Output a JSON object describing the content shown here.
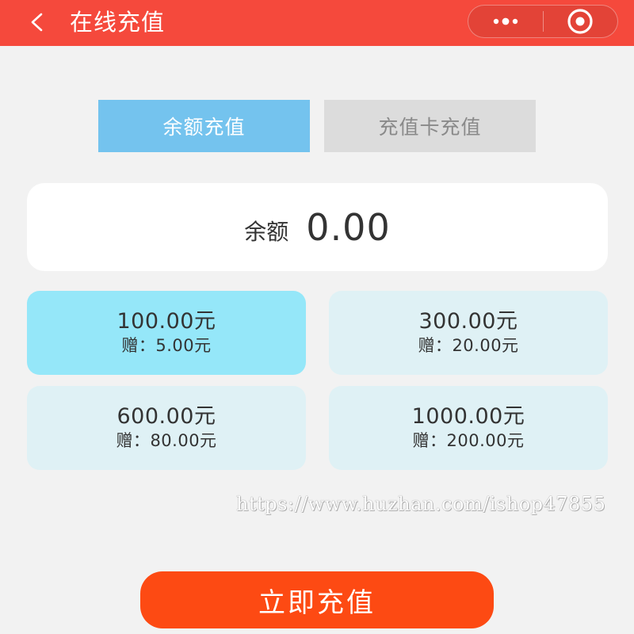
{
  "header": {
    "title": "在线充值",
    "back_icon": "chevron-left-icon",
    "more_icon": "more-dots-icon",
    "close_icon": "target-circle-icon",
    "bg_color": "#f5493c"
  },
  "tabs": [
    {
      "label": "余额充值",
      "active": true
    },
    {
      "label": "充值卡充值",
      "active": false
    }
  ],
  "balance": {
    "label": "余额",
    "value": "0.00"
  },
  "options": [
    {
      "amount": "100.00元",
      "bonus_label": "赠：",
      "bonus_value": "5.00元",
      "selected": true
    },
    {
      "amount": "300.00元",
      "bonus_label": "赠：",
      "bonus_value": "20.00元",
      "selected": false
    },
    {
      "amount": "600.00元",
      "bonus_label": "赠：",
      "bonus_value": "80.00元",
      "selected": false
    },
    {
      "amount": "1000.00元",
      "bonus_label": "赠：",
      "bonus_value": "200.00元",
      "selected": false
    }
  ],
  "watermark": "https://www.huzhan.com/ishop47855",
  "submit": {
    "label": "立即充值",
    "color": "#fd4a13"
  }
}
